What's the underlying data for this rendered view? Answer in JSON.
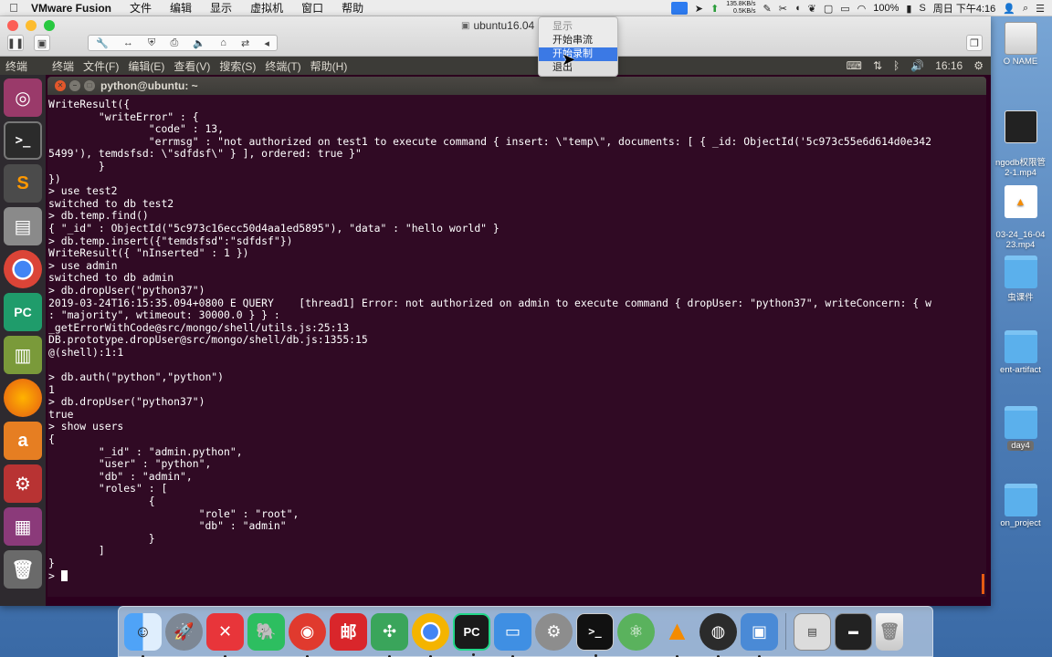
{
  "mac_menubar": {
    "apple_icon": "apple-icon",
    "items": [
      "VMware Fusion",
      "文件",
      "编辑",
      "显示",
      "虚拟机",
      "窗口",
      "帮助"
    ],
    "status": {
      "net_up": "135.8KB/s",
      "net_down": "0.5KB/s",
      "battery": "100%",
      "datetime": "周日 下午4:16"
    }
  },
  "vmware": {
    "title": "ubuntu16.04",
    "dropdown": {
      "items": [
        {
          "label": "显示",
          "state": "disabled"
        },
        {
          "label": "开始串流",
          "state": "normal"
        },
        {
          "label": "开始录制",
          "state": "active"
        },
        {
          "label": "退出",
          "state": "normal"
        }
      ]
    }
  },
  "ubuntu_panel": {
    "app_title": "终端",
    "menus": [
      "终端",
      "文件(F)",
      "编辑(E)",
      "查看(V)",
      "搜索(S)",
      "终端(T)",
      "帮助(H)"
    ],
    "time": "16:16"
  },
  "launcher": {
    "items": [
      {
        "name": "ubuntu-dash",
        "glyph": "◎"
      },
      {
        "name": "terminal",
        "glyph": ">_"
      },
      {
        "name": "sublime-text",
        "glyph": "S"
      },
      {
        "name": "file-manager",
        "glyph": "▤"
      },
      {
        "name": "chrome",
        "glyph": ""
      },
      {
        "name": "pycharm",
        "glyph": "PC"
      },
      {
        "name": "ebook-reader",
        "glyph": "▥"
      },
      {
        "name": "firefox",
        "glyph": ""
      },
      {
        "name": "amazon",
        "glyph": "a"
      },
      {
        "name": "system-settings",
        "glyph": "⚙"
      },
      {
        "name": "workspace-switcher",
        "glyph": "▦"
      },
      {
        "name": "trash",
        "glyph": "🗑"
      }
    ]
  },
  "terminal": {
    "title": "python@ubuntu: ~",
    "lines": [
      "WriteResult({",
      "        \"writeError\" : {",
      "                \"code\" : 13,",
      "                \"errmsg\" : \"not authorized on test1 to execute command { insert: \\\"temp\\\", documents: [ { _id: ObjectId('5c973c55e6d614d0e342",
      "5499'), temdsfsd: \\\"sdfdsf\\\" } ], ordered: true }\"",
      "        }",
      "})",
      "> use test2",
      "switched to db test2",
      "> db.temp.find()",
      "{ \"_id\" : ObjectId(\"5c973c16ecc50d4aa1ed5895\"), \"data\" : \"hello world\" }",
      "> db.temp.insert({\"temdsfsd\":\"sdfdsf\"})",
      "WriteResult({ \"nInserted\" : 1 })",
      "> use admin",
      "switched to db admin",
      "> db.dropUser(\"python37\")",
      "2019-03-24T16:15:35.094+0800 E QUERY    [thread1] Error: not authorized on admin to execute command { dropUser: \"python37\", writeConcern: { w",
      ": \"majority\", wtimeout: 30000.0 } } :",
      "_getErrorWithCode@src/mongo/shell/utils.js:25:13",
      "DB.prototype.dropUser@src/mongo/shell/db.js:1355:15",
      "@(shell):1:1",
      "",
      "> db.auth(\"python\",\"python\")",
      "1",
      "> db.dropUser(\"python37\")",
      "true",
      "> show users",
      "{",
      "        \"_id\" : \"admin.python\",",
      "        \"user\" : \"python\",",
      "        \"db\" : \"admin\",",
      "        \"roles\" : [",
      "                {",
      "                        \"role\" : \"root\",",
      "                        \"db\" : \"admin\"",
      "                }",
      "        ]",
      "}"
    ],
    "prompt": "> "
  },
  "desktop_icons": [
    {
      "label": "O NAME",
      "kind": "drive"
    },
    {
      "label": "ngodb权限管\n2-1.mp4",
      "kind": "video"
    },
    {
      "label": "03-24_16-04\n23.mp4",
      "kind": "vlc"
    },
    {
      "label": "虫课件",
      "kind": "folder"
    },
    {
      "label": "ent-artifact",
      "kind": "folder"
    },
    {
      "label": "day4",
      "kind": "folder",
      "selected": true
    },
    {
      "label": "on_project",
      "kind": "folder"
    }
  ],
  "dock": {
    "items": [
      {
        "name": "finder",
        "glyph": "☺",
        "running": true
      },
      {
        "name": "launchpad",
        "glyph": "🚀",
        "running": false
      },
      {
        "name": "xmind",
        "glyph": "✕",
        "running": true
      },
      {
        "name": "evernote",
        "glyph": "🐘",
        "running": false
      },
      {
        "name": "netease-music",
        "glyph": "◉",
        "running": true
      },
      {
        "name": "mail-app",
        "glyph": "邮",
        "running": false
      },
      {
        "name": "mindnode",
        "glyph": "✣",
        "running": true
      },
      {
        "name": "chrome",
        "glyph": "",
        "running": true
      },
      {
        "name": "pycharm",
        "glyph": "PC",
        "running": true
      },
      {
        "name": "keynote",
        "glyph": "▭",
        "running": true
      },
      {
        "name": "system-preferences",
        "glyph": "⚙",
        "running": false
      },
      {
        "name": "terminal",
        "glyph": ">_",
        "running": true
      },
      {
        "name": "atom",
        "glyph": "⚛",
        "running": false
      },
      {
        "name": "vlc",
        "glyph": "▲",
        "running": true
      },
      {
        "name": "obs",
        "glyph": "◍",
        "running": true
      },
      {
        "name": "vmware-fusion",
        "glyph": "▣",
        "running": true
      }
    ],
    "right_items": [
      {
        "name": "preview-stack",
        "glyph": "▤"
      },
      {
        "name": "screenshot-stack",
        "glyph": "▬"
      },
      {
        "name": "trash",
        "glyph": "🗑"
      }
    ]
  }
}
